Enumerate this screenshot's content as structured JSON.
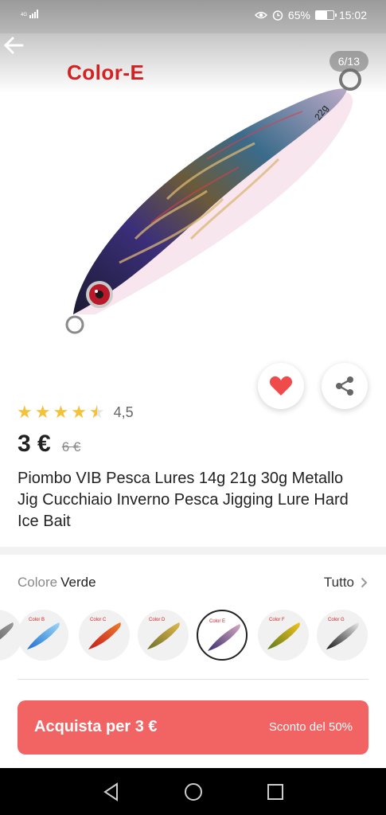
{
  "status_bar": {
    "network": "4G",
    "battery_percent": "65%",
    "battery_level": 0.65,
    "time": "15:02",
    "icons": [
      "signal-icon",
      "eye-icon",
      "alarm-icon",
      "battery-icon"
    ]
  },
  "header": {
    "title": "Color-E",
    "image_counter": "6/13",
    "weight_label": "22g"
  },
  "product": {
    "rating_value": "4,5",
    "rating": 4.5,
    "price": "3 €",
    "old_price": "6 €",
    "title": "Piombo VIB Pesca Lures 14g 21g 30g Metallo Jig Cucchiaio Inverno Pesca Jigging Lure Hard Ice Bait"
  },
  "variants": {
    "label": "Colore",
    "selected": "Verde",
    "all_label": "Tutto",
    "swatches": [
      {
        "label": "",
        "colors": [
          "#555555",
          "#999999"
        ]
      },
      {
        "label": "Color B",
        "colors": [
          "#1f6fd6",
          "#9ad8f5"
        ]
      },
      {
        "label": "Color C",
        "colors": [
          "#c21d1d",
          "#f07a2a"
        ]
      },
      {
        "label": "Color D",
        "colors": [
          "#6b6f2a",
          "#e2b84a"
        ]
      },
      {
        "label": "Color E",
        "colors": [
          "#3a2f6e",
          "#d7a9c2"
        ]
      },
      {
        "label": "Color F",
        "colors": [
          "#5d7a1e",
          "#f2c21b"
        ]
      },
      {
        "label": "Color G",
        "colors": [
          "#1a1a1a",
          "#e8e8e8"
        ]
      }
    ]
  },
  "buy": {
    "label": "Acquista per 3 €",
    "discount": "Sconto del 50%"
  },
  "colors": {
    "accent": "#f26464",
    "brand_red": "#d42222",
    "star": "#f3c23a"
  }
}
